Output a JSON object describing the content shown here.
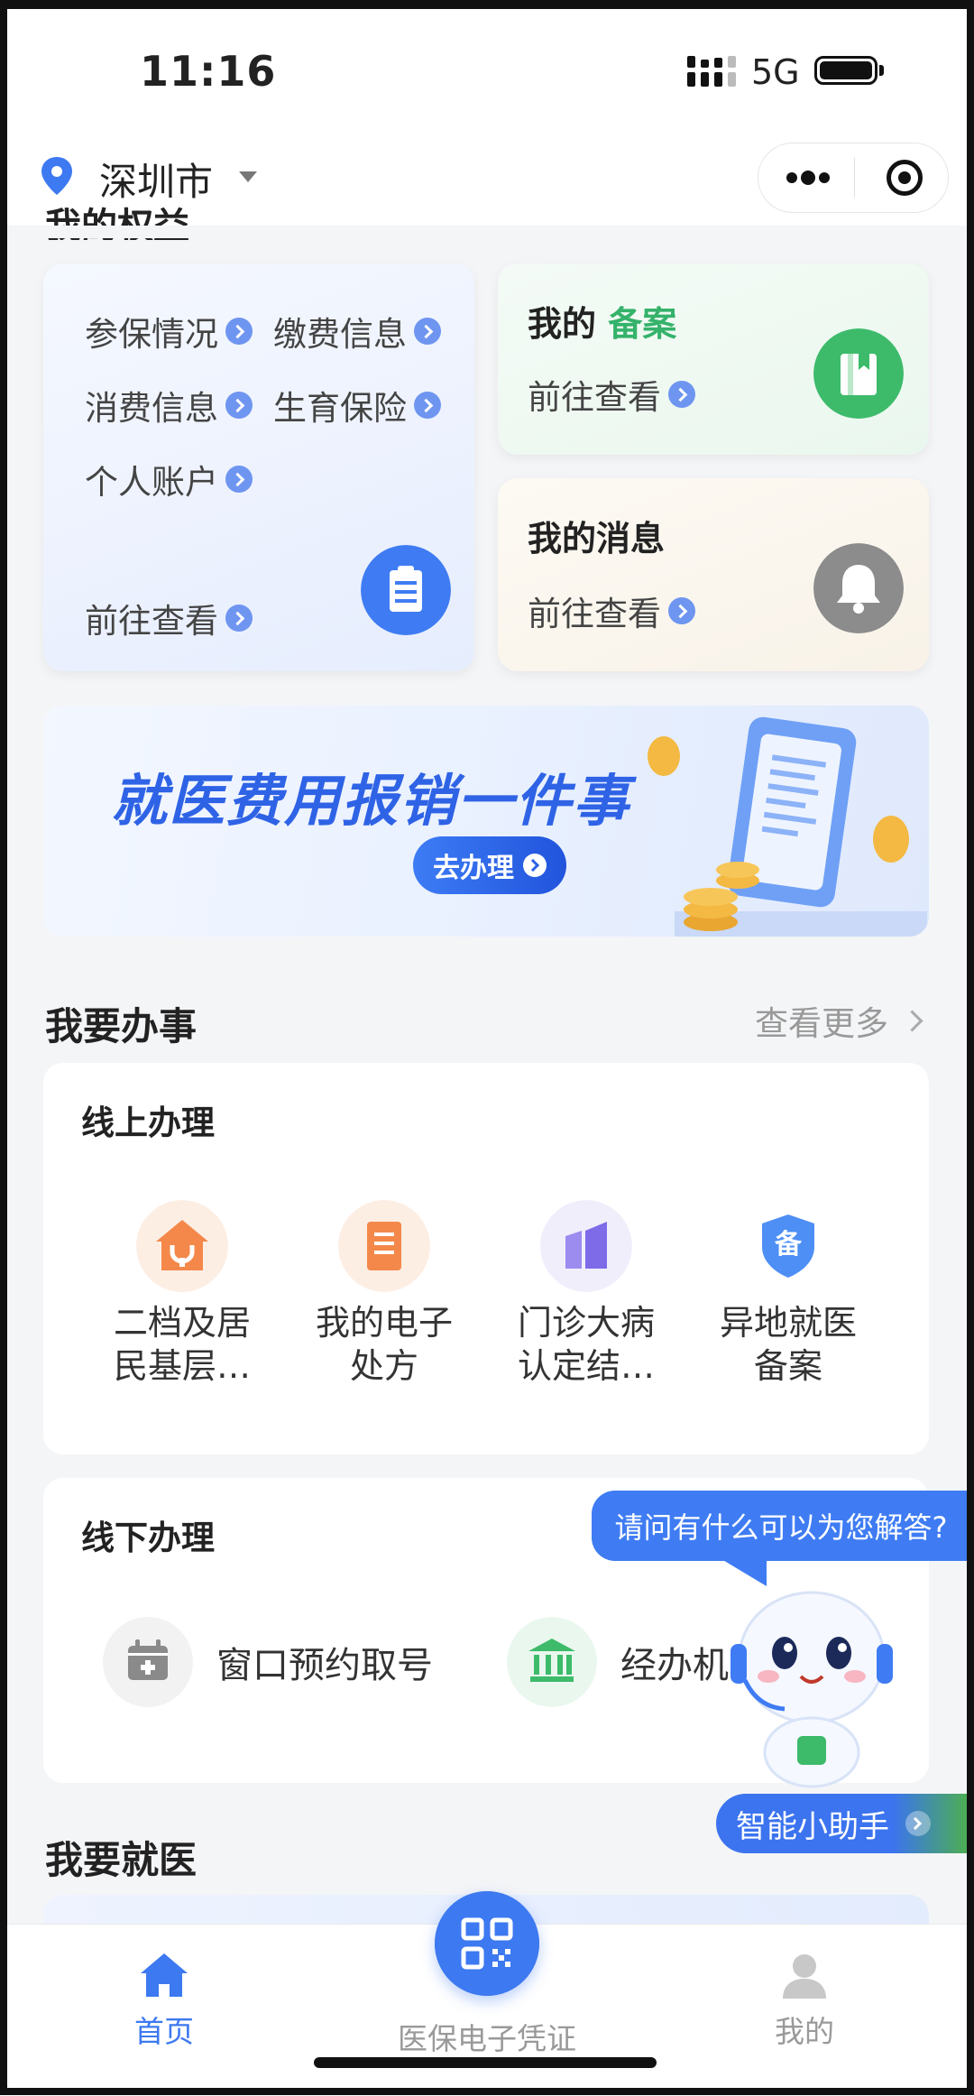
{
  "status_bar": {
    "time": "11:16",
    "network": "5G"
  },
  "nav": {
    "city": "深圳市"
  },
  "section_rights_partial": "我的权益",
  "benefits_card": {
    "links": [
      "参保情况",
      "缴费信息",
      "消费信息",
      "生育保险",
      "个人账户"
    ],
    "action": "前往查看"
  },
  "filing_card": {
    "title_prefix": "我的",
    "title_accent": "备案",
    "action": "前往查看"
  },
  "messages_card": {
    "title": "我的消息",
    "action": "前往查看"
  },
  "banner": {
    "title": "就医费用报销一件事",
    "button": "去办理"
  },
  "todo_section": {
    "title": "我要办事",
    "more": "查看更多",
    "online": {
      "title": "线上办理",
      "items": [
        {
          "line1": "二档及居",
          "line2": "民基层…",
          "icon": "clinic-icon"
        },
        {
          "line1": "我的电子",
          "line2": "处方",
          "icon": "prescription-icon"
        },
        {
          "line1": "门诊大病",
          "line2": "认定结…",
          "icon": "chart-icon"
        },
        {
          "line1": "异地就医",
          "line2": "备案",
          "icon": "shield-icon"
        }
      ],
      "shield_char": "备"
    },
    "offline": {
      "title": "线下办理",
      "items": [
        {
          "label": "窗口预约取号",
          "icon": "calendar-icon"
        },
        {
          "label": "经办机",
          "icon": "bank-icon"
        }
      ]
    }
  },
  "medical_section": {
    "title": "我要就医"
  },
  "assistant": {
    "bubble": "请问有什么可以为您解答?",
    "tab": "智能小助手"
  },
  "tabbar": {
    "home": "首页",
    "voucher": "医保电子凭证",
    "mine": "我的",
    "active_color": "#3d79f0",
    "inactive_color": "#999999"
  }
}
